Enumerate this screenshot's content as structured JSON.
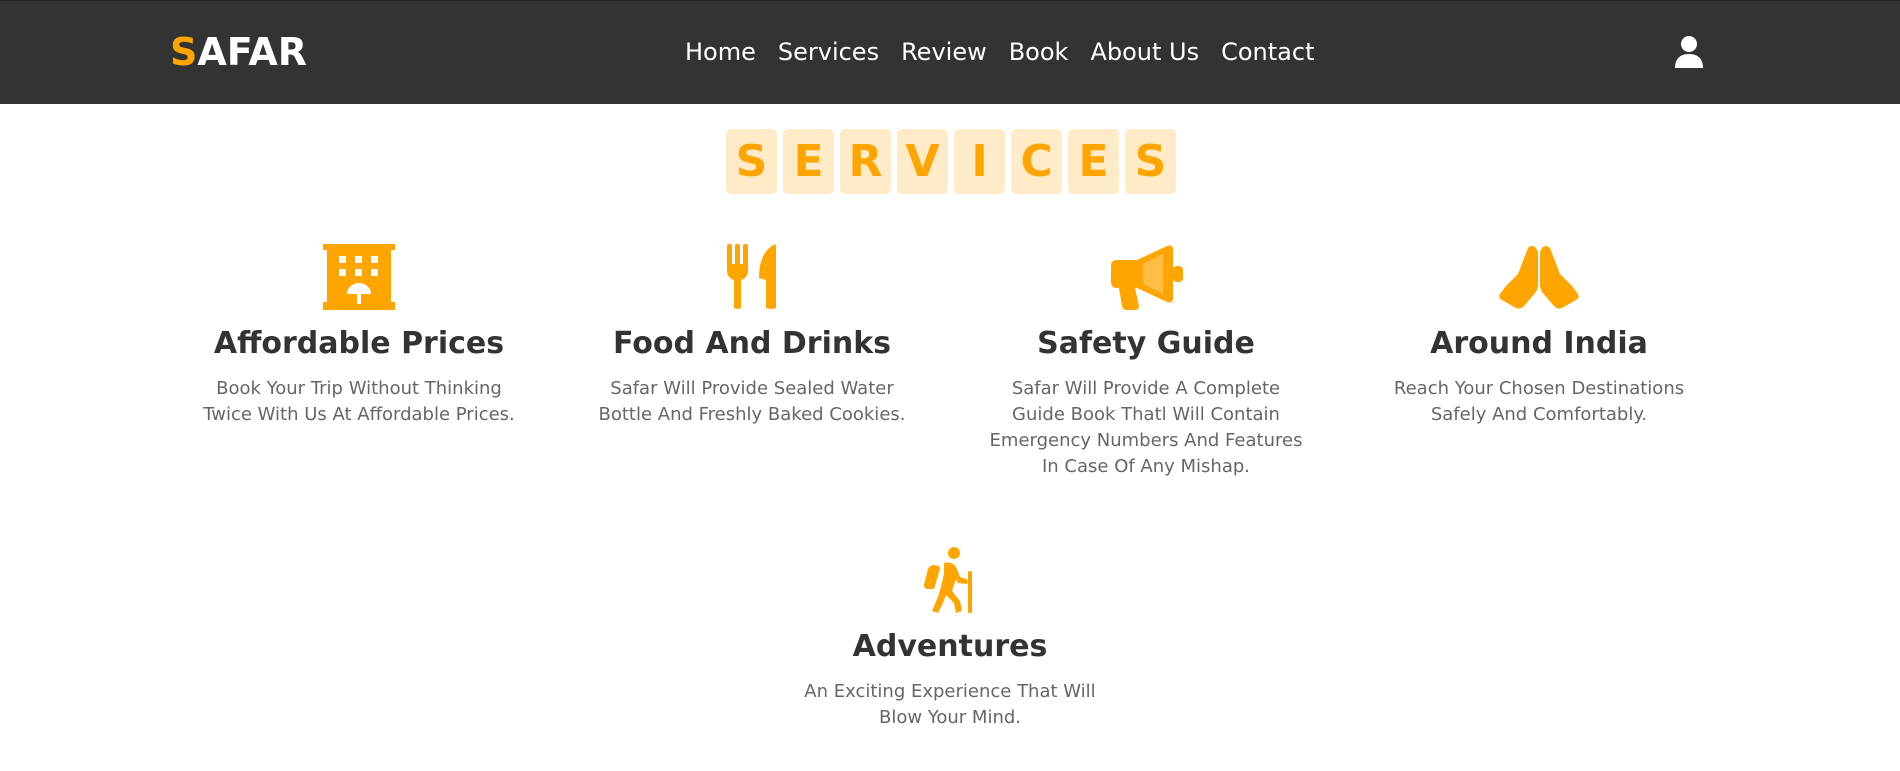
{
  "header": {
    "logo_first": "S",
    "logo_rest": "AFAR",
    "nav": [
      "Home",
      "Services",
      "Review",
      "Book",
      "About Us",
      "Contact"
    ],
    "user_icon": "user-icon"
  },
  "heading": {
    "letters": [
      "S",
      "E",
      "R",
      "V",
      "I",
      "C",
      "E",
      "S"
    ]
  },
  "services": [
    {
      "icon": "hotel-icon",
      "title": "Affordable Prices",
      "desc": "Book Your Trip Without Thinking Twice With Us At Affordable Prices."
    },
    {
      "icon": "utensils-icon",
      "title": "Food And Drinks",
      "desc": "Safar Will Provide Sealed Water Bottle And Freshly Baked Cookies."
    },
    {
      "icon": "bullhorn-icon",
      "title": "Safety Guide",
      "desc": "Safar Will Provide A Complete Guide Book Thatl Will Contain Emergency Numbers And Features In Case Of Any Mishap."
    },
    {
      "icon": "praying-hands-icon",
      "title": "Around India",
      "desc": "Reach Your Chosen Destinations Safely And Comfortably."
    },
    {
      "icon": "hiking-icon",
      "title": "Adventures",
      "desc": "An Exciting Experience That Will Blow Your Mind."
    }
  ],
  "colors": {
    "accent": "#ffa500",
    "header_bg": "#333333",
    "letter_bg": "#ffebc7",
    "text_dark": "#333333",
    "text_muted": "#666666"
  }
}
